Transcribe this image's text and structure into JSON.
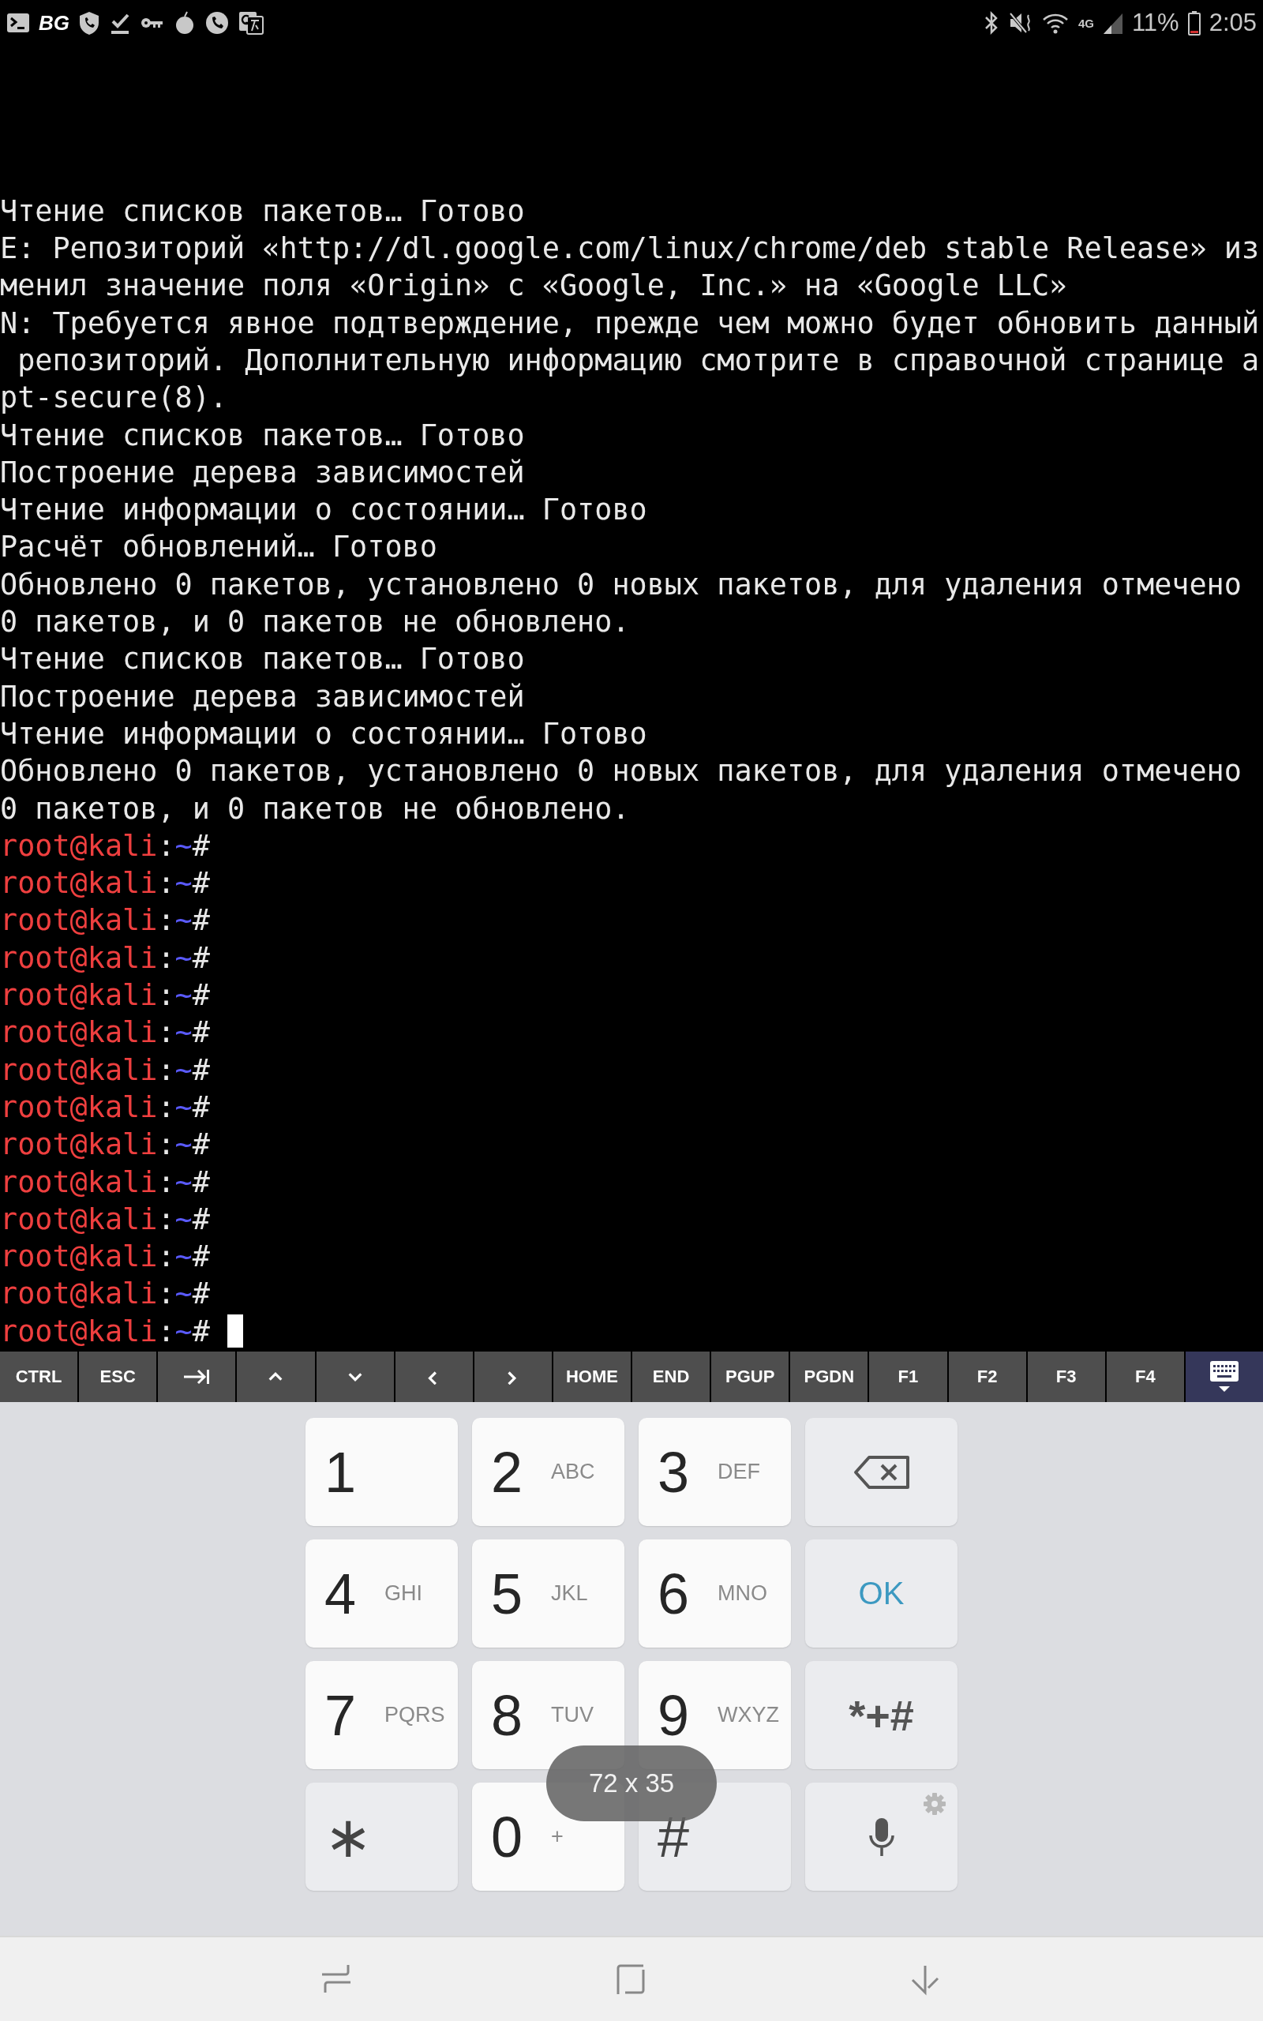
{
  "status_bar": {
    "badge": "BG",
    "network": "4G",
    "battery": "11%",
    "time": "2:05"
  },
  "terminal": {
    "lines": [
      {
        "kind": "output",
        "text": "Чтение списков пакетов… Готово"
      },
      {
        "kind": "output",
        "text": "E: Репозиторий «http://dl.google.com/linux/chrome/deb stable Release» из"
      },
      {
        "kind": "output",
        "text": "менил значение поля «Origin» с «Google, Inc.» на «Google LLC»"
      },
      {
        "kind": "output",
        "text": "N: Требуется явное подтверждение, прежде чем можно будет обновить данный"
      },
      {
        "kind": "output",
        "text": " репозиторий. Дополнительную информацию смотрите в справочной странице а"
      },
      {
        "kind": "output",
        "text": "pt-secure(8)."
      },
      {
        "kind": "output",
        "text": "Чтение списков пакетов… Готово"
      },
      {
        "kind": "output",
        "text": "Построение дерева зависимостей"
      },
      {
        "kind": "output",
        "text": "Чтение информации о состоянии… Готово"
      },
      {
        "kind": "output",
        "text": "Расчёт обновлений… Готово"
      },
      {
        "kind": "output",
        "text": "Обновлено 0 пакетов, установлено 0 новых пакетов, для удаления отмечено"
      },
      {
        "kind": "output",
        "text": "0 пакетов, и 0 пакетов не обновлено."
      },
      {
        "kind": "output",
        "text": "Чтение списков пакетов… Готово"
      },
      {
        "kind": "output",
        "text": "Построение дерева зависимостей"
      },
      {
        "kind": "output",
        "text": "Чтение информации о состоянии… Готово"
      },
      {
        "kind": "output",
        "text": "Обновлено 0 пакетов, установлено 0 новых пакетов, для удаления отмечено"
      },
      {
        "kind": "output",
        "text": "0 пакетов, и 0 пакетов не обновлено."
      },
      {
        "kind": "prompt",
        "user": "root@kali",
        "colon": ":",
        "path": "~",
        "symbol": "#",
        "cursor": false
      },
      {
        "kind": "prompt",
        "user": "root@kali",
        "colon": ":",
        "path": "~",
        "symbol": "#",
        "cursor": false
      },
      {
        "kind": "prompt",
        "user": "root@kali",
        "colon": ":",
        "path": "~",
        "symbol": "#",
        "cursor": false
      },
      {
        "kind": "prompt",
        "user": "root@kali",
        "colon": ":",
        "path": "~",
        "symbol": "#",
        "cursor": false
      },
      {
        "kind": "prompt",
        "user": "root@kali",
        "colon": ":",
        "path": "~",
        "symbol": "#",
        "cursor": false
      },
      {
        "kind": "prompt",
        "user": "root@kali",
        "colon": ":",
        "path": "~",
        "symbol": "#",
        "cursor": false
      },
      {
        "kind": "prompt",
        "user": "root@kali",
        "colon": ":",
        "path": "~",
        "symbol": "#",
        "cursor": false
      },
      {
        "kind": "prompt",
        "user": "root@kali",
        "colon": ":",
        "path": "~",
        "symbol": "#",
        "cursor": false
      },
      {
        "kind": "prompt",
        "user": "root@kali",
        "colon": ":",
        "path": "~",
        "symbol": "#",
        "cursor": false
      },
      {
        "kind": "prompt",
        "user": "root@kali",
        "colon": ":",
        "path": "~",
        "symbol": "#",
        "cursor": false
      },
      {
        "kind": "prompt",
        "user": "root@kali",
        "colon": ":",
        "path": "~",
        "symbol": "#",
        "cursor": false
      },
      {
        "kind": "prompt",
        "user": "root@kali",
        "colon": ":",
        "path": "~",
        "symbol": "#",
        "cursor": false
      },
      {
        "kind": "prompt",
        "user": "root@kali",
        "colon": ":",
        "path": "~",
        "symbol": "#",
        "cursor": false
      },
      {
        "kind": "prompt",
        "user": "root@kali",
        "colon": ":",
        "path": "~",
        "symbol": "#",
        "cursor": true
      }
    ]
  },
  "extra_keys": [
    {
      "kind": "text",
      "label": "CTRL",
      "selected": false
    },
    {
      "kind": "text",
      "label": "ESC",
      "selected": false
    },
    {
      "kind": "tab",
      "selected": false
    },
    {
      "kind": "up",
      "selected": false
    },
    {
      "kind": "down",
      "selected": false
    },
    {
      "kind": "left",
      "selected": false
    },
    {
      "kind": "right",
      "selected": false
    },
    {
      "kind": "text",
      "label": "HOME",
      "selected": false
    },
    {
      "kind": "text",
      "label": "END",
      "selected": false
    },
    {
      "kind": "text",
      "label": "PGUP",
      "selected": false
    },
    {
      "kind": "text",
      "label": "PGDN",
      "selected": false
    },
    {
      "kind": "text",
      "label": "F1",
      "selected": false
    },
    {
      "kind": "text",
      "label": "F2",
      "selected": false
    },
    {
      "kind": "text",
      "label": "F3",
      "selected": false
    },
    {
      "kind": "text",
      "label": "F4",
      "selected": false
    },
    {
      "kind": "keyboard",
      "selected": true
    }
  ],
  "keypad": {
    "keys": [
      {
        "kind": "digit",
        "digit": "1"
      },
      {
        "kind": "digit",
        "digit": "2",
        "letters": "ABC"
      },
      {
        "kind": "digit",
        "digit": "3",
        "letters": "DEF"
      },
      {
        "kind": "backspace"
      },
      {
        "kind": "digit",
        "digit": "4",
        "letters": "GHI"
      },
      {
        "kind": "digit",
        "digit": "5",
        "letters": "JKL"
      },
      {
        "kind": "digit",
        "digit": "6",
        "letters": "MNO"
      },
      {
        "kind": "ok",
        "label": "OK"
      },
      {
        "kind": "digit",
        "digit": "7",
        "letters": "PQRS"
      },
      {
        "kind": "digit",
        "digit": "8",
        "letters": "TUV"
      },
      {
        "kind": "digit",
        "digit": "9",
        "letters": "WXYZ"
      },
      {
        "kind": "symbols",
        "label": "*+#"
      },
      {
        "kind": "symbol",
        "label": "∗"
      },
      {
        "kind": "digit",
        "digit": "0",
        "letters": "+"
      },
      {
        "kind": "symbol",
        "label": "#"
      },
      {
        "kind": "mic"
      }
    ]
  },
  "toast": {
    "text": "72 x 35"
  }
}
